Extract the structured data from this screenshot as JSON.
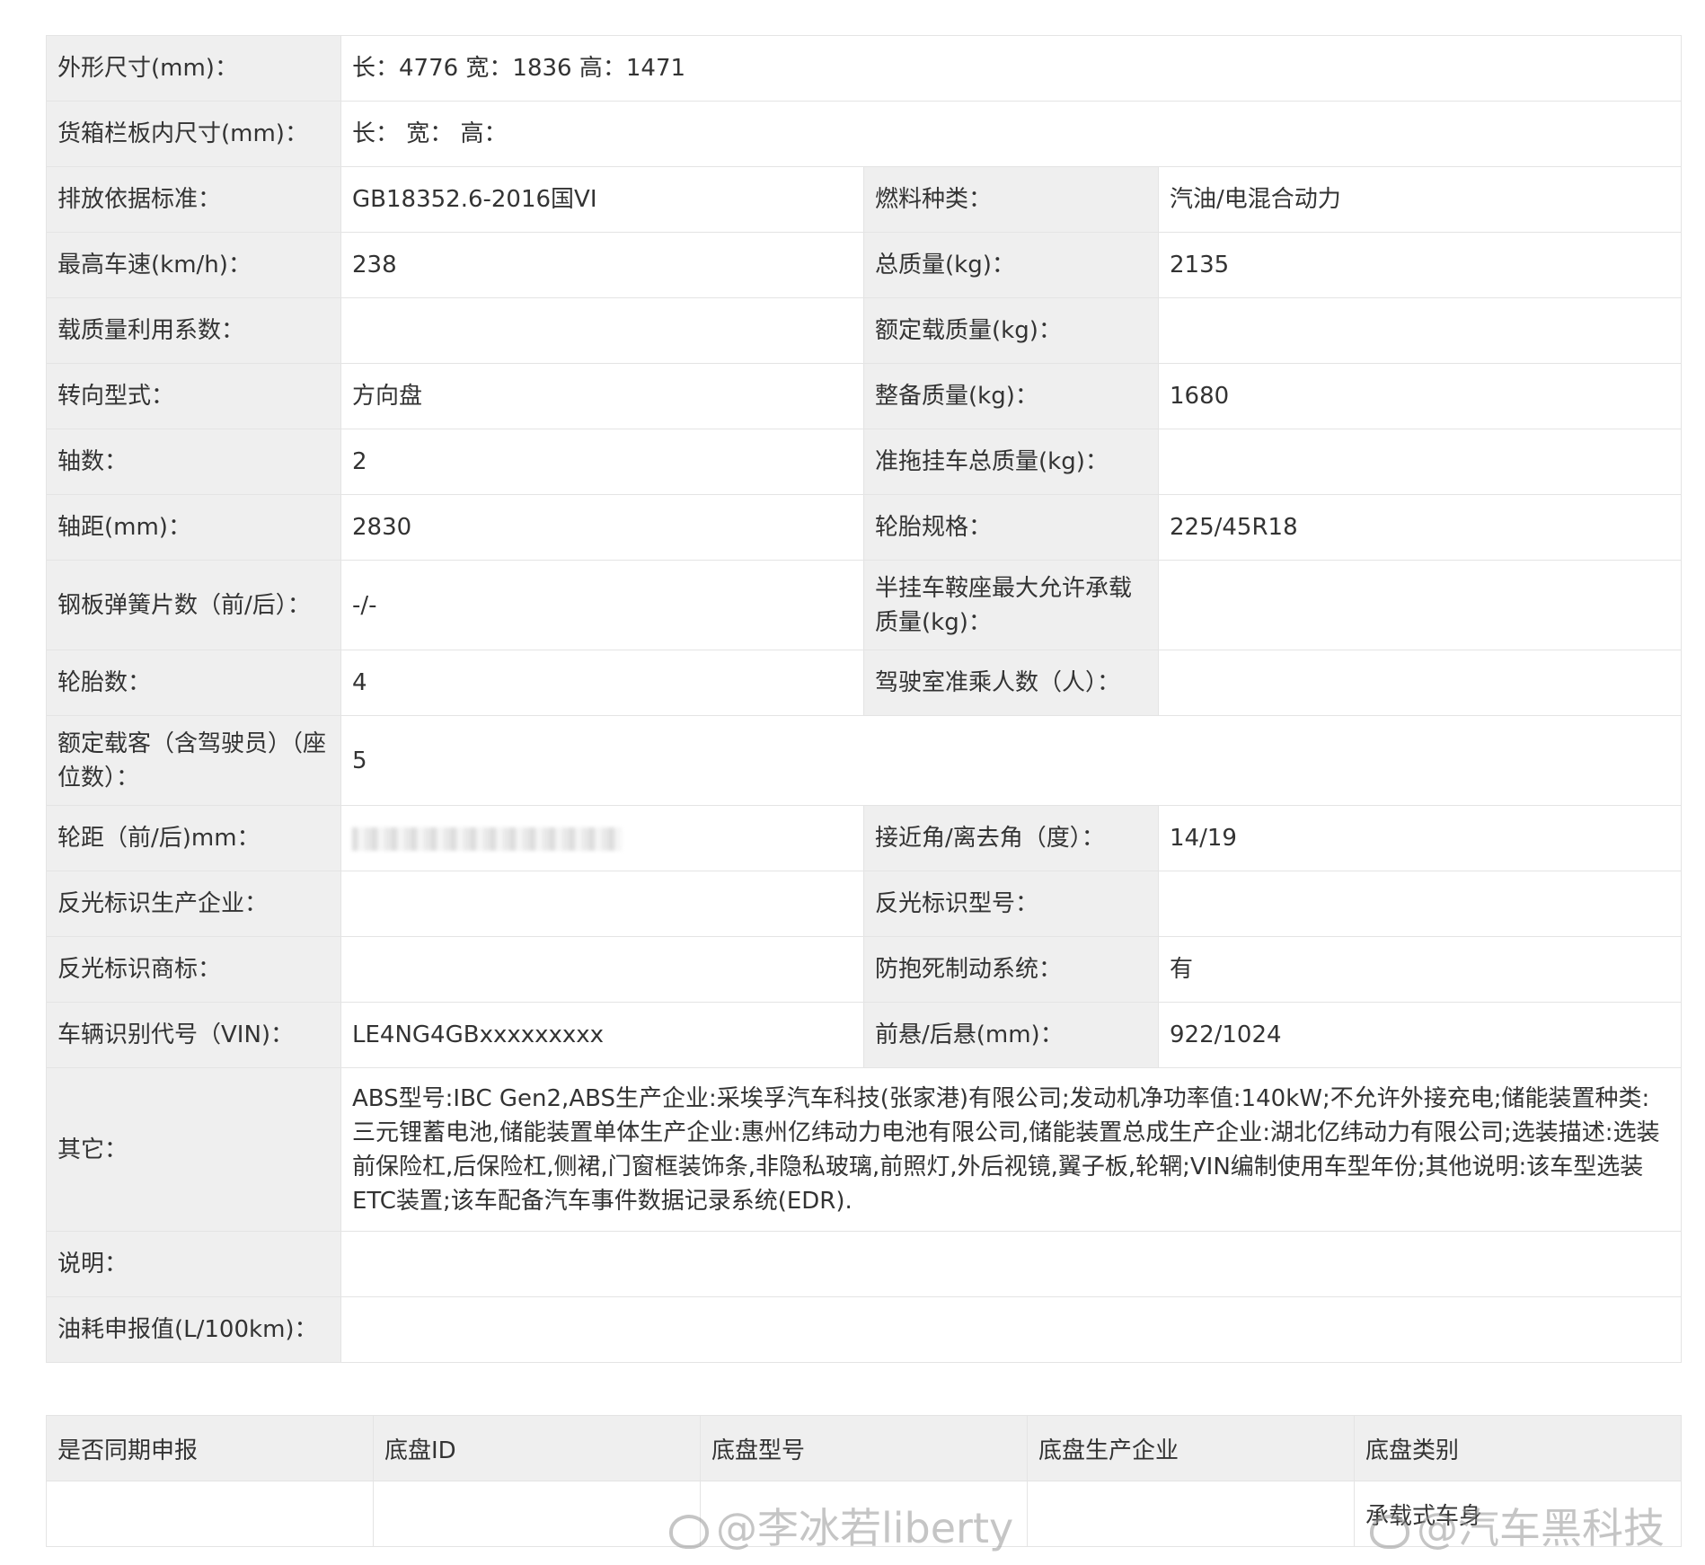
{
  "spec": {
    "dimensions": {
      "label": "外形尺寸(mm)：",
      "value": "长：4776 宽：1836 高：1471"
    },
    "cargo_dims": {
      "label": "货箱栏板内尺寸(mm)：",
      "value": "长：  宽：  高："
    },
    "emission": {
      "label": "排放依据标准：",
      "value": "GB18352.6-2016国VI"
    },
    "fuel": {
      "label": "燃料种类：",
      "value": "汽油/电混合动力"
    },
    "max_speed": {
      "label": "最高车速(km/h)：",
      "value": "238"
    },
    "total_mass": {
      "label": "总质量(kg)：",
      "value": "2135"
    },
    "load_coeff": {
      "label": "载质量利用系数：",
      "value": ""
    },
    "rated_load": {
      "label": "额定载质量(kg)：",
      "value": ""
    },
    "steering": {
      "label": "转向型式：",
      "value": "方向盘"
    },
    "curb_mass": {
      "label": "整备质量(kg)：",
      "value": "1680"
    },
    "axles": {
      "label": "轴数：",
      "value": "2"
    },
    "trailer_mass": {
      "label": "准拖挂车总质量(kg)：",
      "value": ""
    },
    "wheelbase": {
      "label": "轴距(mm)：",
      "value": "2830"
    },
    "tire_spec": {
      "label": "轮胎规格：",
      "value": "225/45R18"
    },
    "leaf_springs": {
      "label": "钢板弹簧片数（前/后）：",
      "value": "-/-"
    },
    "semi_trailer": {
      "label": "半挂车鞍座最大允许承载质量(kg)：",
      "value": ""
    },
    "tires": {
      "label": "轮胎数：",
      "value": "4"
    },
    "cab_seats": {
      "label": "驾驶室准乘人数（人）：",
      "value": ""
    },
    "passengers": {
      "label": "额定载客（含驾驶员）（座位数）：",
      "value": "5"
    },
    "track": {
      "label": "轮距（前/后)mm：",
      "value": ""
    },
    "angles": {
      "label": "接近角/离去角（度）：",
      "value": "14/19"
    },
    "reflector_maker": {
      "label": "反光标识生产企业：",
      "value": ""
    },
    "reflector_model": {
      "label": "反光标识型号：",
      "value": ""
    },
    "reflector_brand": {
      "label": "反光标识商标：",
      "value": ""
    },
    "abs": {
      "label": "防抱死制动系统：",
      "value": "有"
    },
    "vin": {
      "label": "车辆识别代号（VIN)：",
      "value": "LE4NG4GBxxxxxxxxx"
    },
    "overhang": {
      "label": "前悬/后悬(mm)：",
      "value": "922/1024"
    },
    "other": {
      "label": "其它：",
      "value": "ABS型号:IBC Gen2,ABS生产企业:采埃孚汽车科技(张家港)有限公司;发动机净功率值:140kW;不允许外接充电;储能装置种类:三元锂蓄电池,储能装置单体生产企业:惠州亿纬动力电池有限公司,储能装置总成生产企业:湖北亿纬动力有限公司;选装描述:选装前保险杠,后保险杠,侧裙,门窗框装饰条,非隐私玻璃,前照灯,外后视镜,翼子板,轮辋;VIN编制使用车型年份;其他说明:该车型选装ETC装置;该车配备汽车事件数据记录系统(EDR)."
    },
    "note": {
      "label": "说明：",
      "value": ""
    },
    "fuel_cons": {
      "label": "油耗申报值(L/100km)：",
      "value": ""
    }
  },
  "chassis": {
    "headers": [
      "是否同期申报",
      "底盘ID",
      "底盘型号",
      "底盘生产企业",
      "底盘类别"
    ],
    "row": [
      "",
      "",
      "",
      "",
      "承载式车身"
    ]
  },
  "watermarks": {
    "left": "@李冰若liberty",
    "right": "@汽车黑科技"
  }
}
